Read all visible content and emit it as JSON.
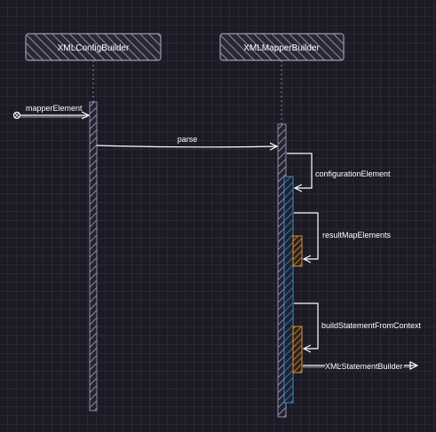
{
  "participants": {
    "left": "XMLConfigBuilder",
    "right": "XMLMapperBuilder"
  },
  "messages": {
    "mapper_element": "mapperElement",
    "parse": "parse",
    "configuration_element": "configurationElement",
    "result_map_elements": "resultMapElements",
    "build_statement_from_context": "buildStatementFromContext",
    "xml_statement_builder": "XMLStatementBuilder"
  },
  "colors": {
    "background": "#1c1a24",
    "line": "#ffffff",
    "activation_primary": "#8f88b0",
    "activation_nested": "#3b8bc4",
    "activation_inner": "#e0902a"
  }
}
